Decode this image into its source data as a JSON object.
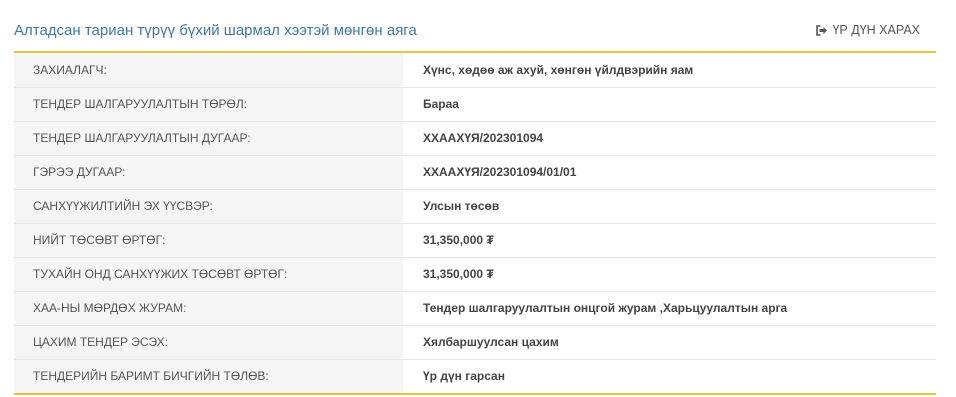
{
  "header": {
    "title": "Алтадсан тариан түрүү бүхий шармал хээтэй мөнгөн аяга",
    "result_link_label": "ҮР ДҮН ХАРАХ",
    "result_link_icon": "sign-out-icon"
  },
  "rows": [
    {
      "label": "ЗАХИАЛАГЧ:",
      "value": "Хүнс, хөдөө аж ахуй, хөнгөн үйлдвэрийн яам"
    },
    {
      "label": "ТЕНДЕР ШАЛГАРУУЛАЛТЫН ТӨРӨЛ:",
      "value": "Бараа"
    },
    {
      "label": "ТЕНДЕР ШАЛГАРУУЛАЛТЫН ДУГААР:",
      "value": "ХХААХҮЯ/202301094"
    },
    {
      "label": "ГЭРЭЭ ДУГААР:",
      "value": "ХХААХҮЯ/202301094/01/01"
    },
    {
      "label": "САНХҮҮЖИЛТИЙН ЭХ ҮҮСВЭР:",
      "value": "Улсын төсөв"
    },
    {
      "label": "НИЙТ ТӨСӨВТ ӨРТӨГ:",
      "value": "31,350,000 ₮"
    },
    {
      "label": "ТУХАЙН ОНД САНХҮҮЖИХ ТӨСӨВТ ӨРТӨГ:",
      "value": "31,350,000 ₮"
    },
    {
      "label": "ХАА-НЫ МӨРДӨХ ЖУРАМ:",
      "value": "Тендер шалгаруулалтын онцгой журам ,Харьцуулалтын арга"
    },
    {
      "label": "ЦАХИМ ТЕНДЕР ЭСЭХ:",
      "value": "Хялбаршуулсан цахим"
    },
    {
      "label": "ТЕНДЕРИЙН БАРИМТ БИЧГИЙН ТӨЛӨВ:",
      "value": "Үр дүн гарсан"
    }
  ],
  "colors": {
    "title": "#3d7aa3",
    "accent_border": "#e8c33b",
    "label_bg": "#f5f5f5"
  }
}
